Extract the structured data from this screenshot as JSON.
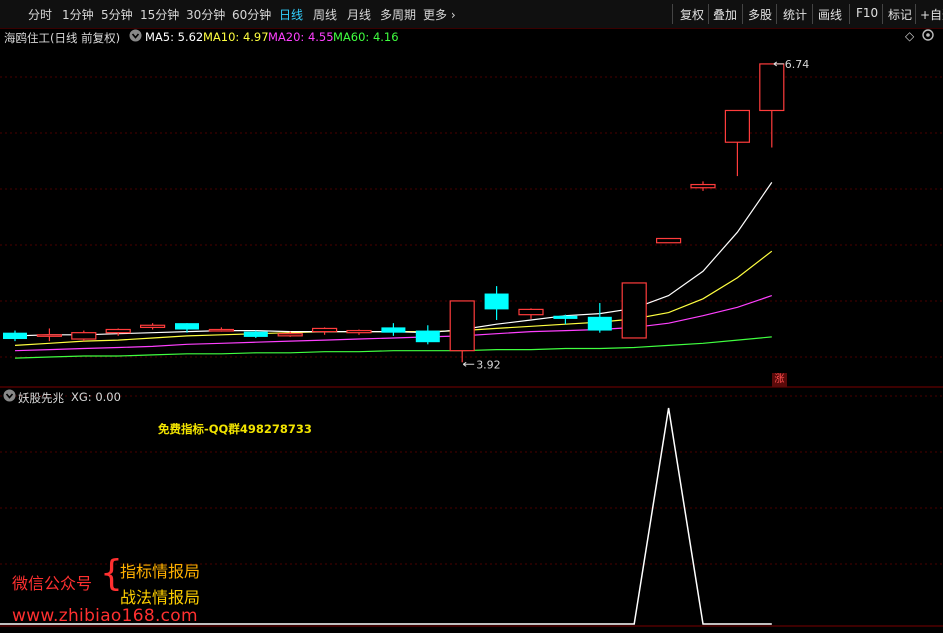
{
  "toolbar": {
    "periods": [
      "分时",
      "1分钟",
      "5分钟",
      "15分钟",
      "30分钟",
      "60分钟",
      "日线",
      "周线",
      "月线",
      "多周期",
      "更多"
    ],
    "active_period": "日线",
    "right_buttons": [
      "复权",
      "叠加",
      "多股",
      "统计",
      "画线",
      "F10",
      "标记",
      "+自选"
    ]
  },
  "stock": {
    "title": "海鸥住工(日线 前复权)",
    "ma5": "MA5: 5.62",
    "ma10": "MA10: 4.97",
    "ma20": "MA20: 4.55",
    "ma60": "MA60: 4.16"
  },
  "annotations": {
    "high_label": "6.74",
    "low_label": "3.92",
    "limit_up_badge": "涨"
  },
  "indicator": {
    "name": "妖股先兆",
    "value": "XG: 0.00",
    "watermark": "免费指标-QQ群498278733"
  },
  "promo": {
    "wechat_label": "微信公众号",
    "name1": "指标情报局",
    "name2": "战法情报局",
    "site": "www.zhibiao168.com"
  },
  "colors": {
    "up": "#ff3c3c",
    "down": "#00ffff",
    "ma5": "#ffffff",
    "ma10": "#ffff40",
    "ma20": "#ff40ff",
    "ma60": "#40ff40",
    "grid": "#4a0000"
  },
  "chart_data": {
    "type": "candlestick",
    "price_axis": [
      3.8,
      6.9
    ],
    "candles": [
      {
        "o": 4.2,
        "c": 4.14,
        "h": 4.22,
        "l": 4.12
      },
      {
        "o": 4.18,
        "c": 4.18,
        "h": 4.24,
        "l": 4.12
      },
      {
        "o": 4.14,
        "c": 4.2,
        "h": 4.22,
        "l": 4.12
      },
      {
        "o": 4.2,
        "c": 4.23,
        "h": 4.24,
        "l": 4.17
      },
      {
        "o": 4.25,
        "c": 4.27,
        "h": 4.29,
        "l": 4.23
      },
      {
        "o": 4.29,
        "c": 4.23,
        "h": 4.29,
        "l": 4.2
      },
      {
        "o": 4.23,
        "c": 4.23,
        "h": 4.25,
        "l": 4.21
      },
      {
        "o": 4.21,
        "c": 4.16,
        "h": 4.22,
        "l": 4.15
      },
      {
        "o": 4.17,
        "c": 4.19,
        "h": 4.21,
        "l": 4.16
      },
      {
        "o": 4.21,
        "c": 4.24,
        "h": 4.25,
        "l": 4.18
      },
      {
        "o": 4.2,
        "c": 4.22,
        "h": 4.23,
        "l": 4.18
      },
      {
        "o": 4.25,
        "c": 4.2,
        "h": 4.29,
        "l": 4.17
      },
      {
        "o": 4.22,
        "c": 4.11,
        "h": 4.27,
        "l": 4.09
      },
      {
        "o": 4.03,
        "c": 4.5,
        "h": 4.5,
        "l": 3.92
      },
      {
        "o": 4.57,
        "c": 4.42,
        "h": 4.64,
        "l": 4.32
      },
      {
        "o": 4.37,
        "c": 4.42,
        "h": 4.43,
        "l": 4.33
      },
      {
        "o": 4.36,
        "c": 4.33,
        "h": 4.37,
        "l": 4.28
      },
      {
        "o": 4.35,
        "c": 4.22,
        "h": 4.48,
        "l": 4.2
      },
      {
        "o": 4.15,
        "c": 4.67,
        "h": 4.67,
        "l": 4.15
      },
      {
        "o": 5.05,
        "c": 5.09,
        "h": 5.09,
        "l": 5.05
      },
      {
        "o": 5.57,
        "c": 5.6,
        "h": 5.63,
        "l": 5.54
      },
      {
        "o": 6.0,
        "c": 6.3,
        "h": 6.3,
        "l": 5.68
      },
      {
        "o": 6.3,
        "c": 6.74,
        "h": 6.74,
        "l": 5.95
      }
    ],
    "ma5": [
      4.17,
      4.18,
      4.18,
      4.19,
      4.2,
      4.21,
      4.22,
      4.22,
      4.21,
      4.21,
      4.21,
      4.21,
      4.2,
      4.23,
      4.28,
      4.32,
      4.36,
      4.38,
      4.43,
      4.55,
      4.78,
      5.15,
      5.62
    ],
    "ma10": [
      4.08,
      4.1,
      4.12,
      4.13,
      4.15,
      4.17,
      4.18,
      4.19,
      4.2,
      4.21,
      4.21,
      4.21,
      4.21,
      4.22,
      4.24,
      4.26,
      4.28,
      4.3,
      4.33,
      4.39,
      4.52,
      4.72,
      4.97
    ],
    "ma20": [
      4.03,
      4.04,
      4.05,
      4.06,
      4.07,
      4.09,
      4.1,
      4.11,
      4.12,
      4.13,
      4.14,
      4.15,
      4.16,
      4.17,
      4.19,
      4.21,
      4.22,
      4.23,
      4.25,
      4.29,
      4.36,
      4.44,
      4.55
    ],
    "ma60": [
      3.96,
      3.97,
      3.98,
      3.98,
      3.99,
      4.0,
      4.0,
      4.01,
      4.01,
      4.02,
      4.02,
      4.03,
      4.03,
      4.03,
      4.04,
      4.04,
      4.05,
      4.05,
      4.06,
      4.08,
      4.1,
      4.13,
      4.16
    ],
    "indicator_values": [
      0,
      0,
      0,
      0,
      0,
      0,
      0,
      0,
      0,
      0,
      0,
      0,
      0,
      0,
      0,
      0,
      0,
      0,
      0,
      1,
      0,
      0,
      0
    ]
  }
}
